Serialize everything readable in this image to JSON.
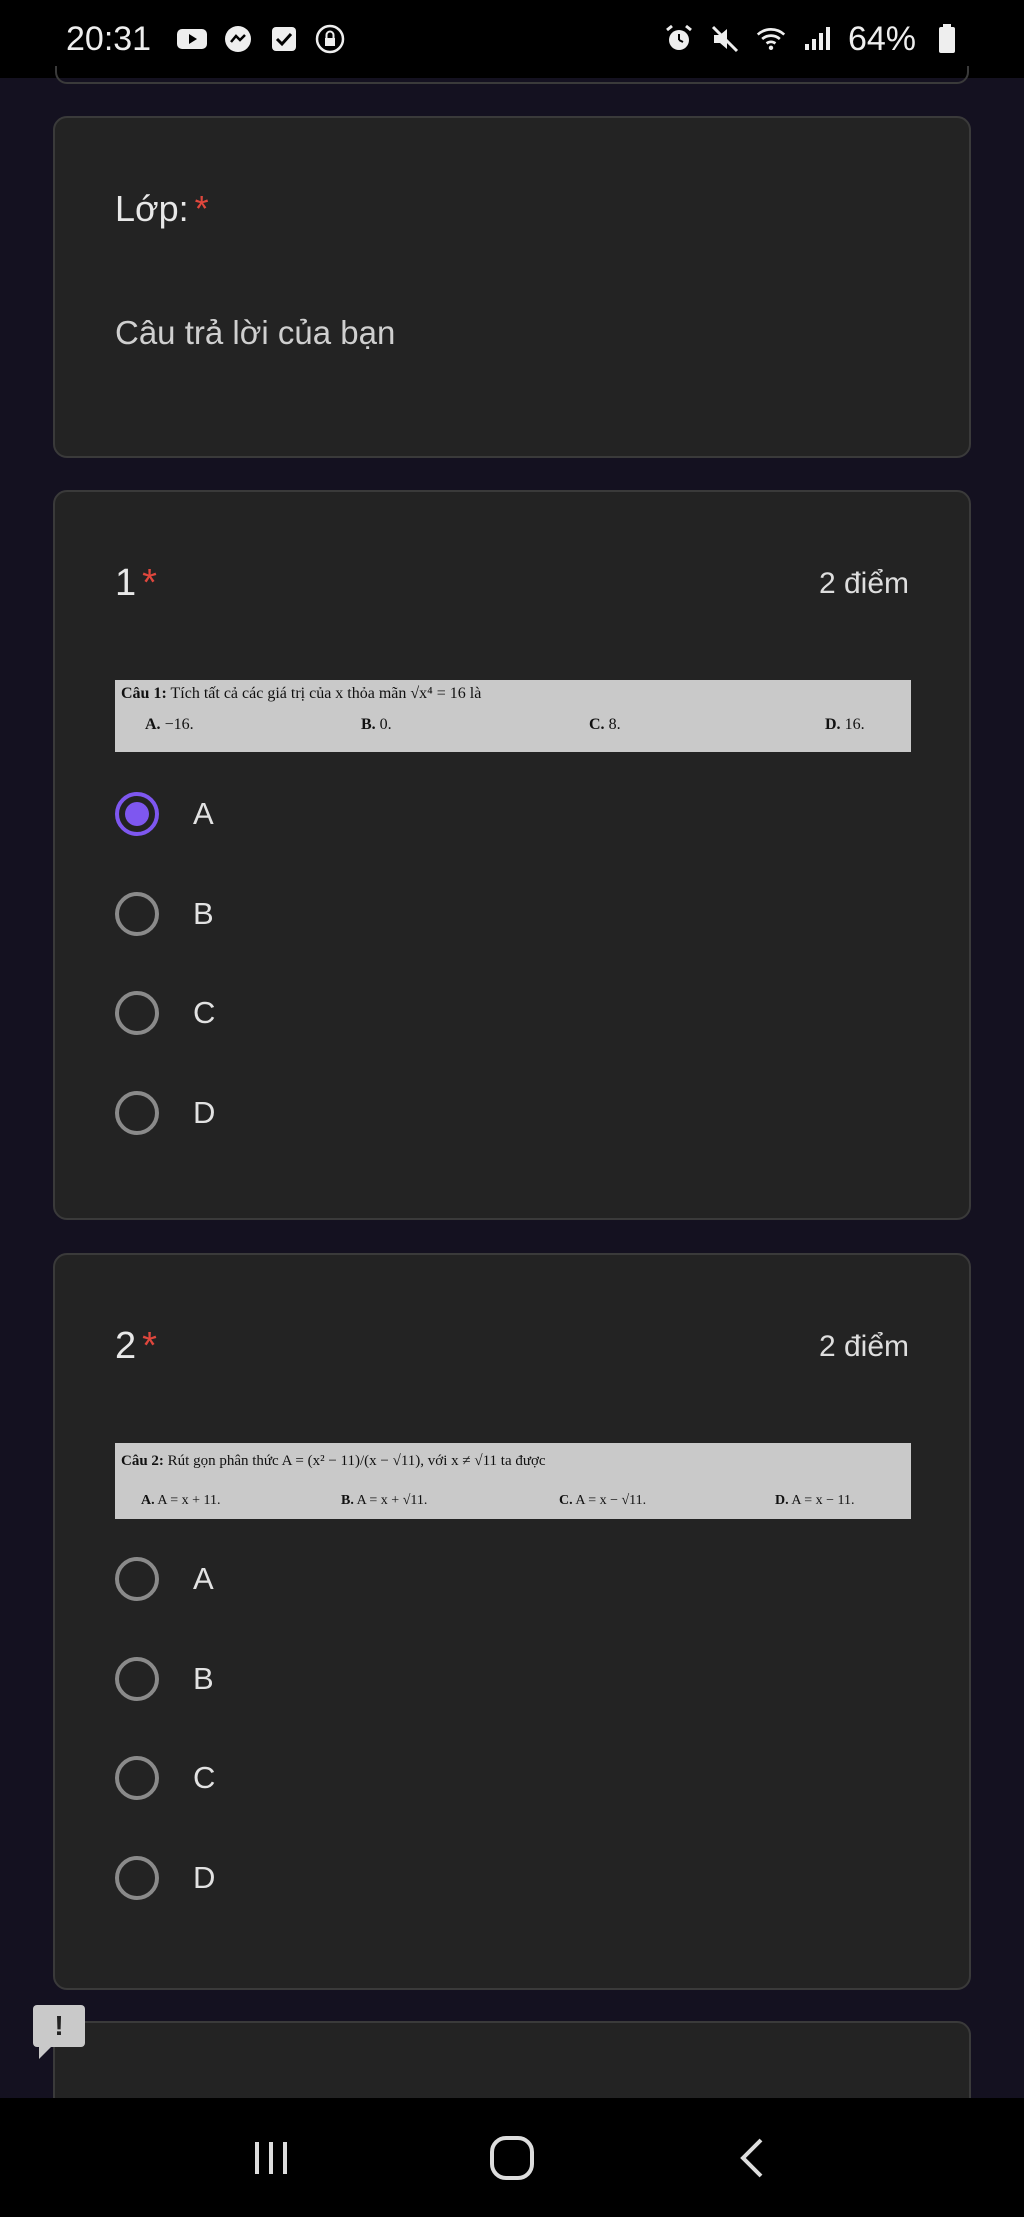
{
  "status_bar": {
    "time": "20:31",
    "battery_pct": "64%",
    "left_icons": [
      "youtube-icon",
      "messenger-icon",
      "checkbox-icon",
      "lock-icon"
    ],
    "right_icons": [
      "alarm-icon",
      "mute-icon",
      "wifi-icon",
      "signal-icon",
      "battery-icon"
    ]
  },
  "class_field": {
    "label": "Lớp:",
    "required_mark": "*",
    "placeholder": "Câu trả lời của bạn"
  },
  "questions": [
    {
      "number": "1",
      "required_mark": "*",
      "points": "2 điểm",
      "stem": "Câu 1: Tích tất cả các giá trị của x thỏa mãn √(x⁴) = 16 là",
      "stem_label": "Câu 1:",
      "stem_text": "Tích tất cả các giá trị của x thỏa mãn √x⁴ = 16 là",
      "image_options": [
        {
          "letter": "A.",
          "text": "−16."
        },
        {
          "letter": "B.",
          "text": "0."
        },
        {
          "letter": "C.",
          "text": "8."
        },
        {
          "letter": "D.",
          "text": "16."
        }
      ],
      "options": [
        "A",
        "B",
        "C",
        "D"
      ],
      "selected": "A"
    },
    {
      "number": "2",
      "required_mark": "*",
      "points": "2 điểm",
      "stem_label": "Câu 2:",
      "stem_text": "Rút gọn phân thức A = (x² − 11)/(x − √11), với x ≠ √11 ta được",
      "image_options": [
        {
          "letter": "A.",
          "text": "A = x + 11."
        },
        {
          "letter": "B.",
          "text": "A = x + √11."
        },
        {
          "letter": "C.",
          "text": "A = x − √11."
        },
        {
          "letter": "D.",
          "text": "A = x − 11."
        }
      ],
      "options": [
        "A",
        "B",
        "C",
        "D"
      ],
      "selected": null
    }
  ],
  "feedback_button": {
    "label": "!"
  },
  "colors": {
    "background": "#141120",
    "card": "#232323",
    "accent": "#7e57f0",
    "required": "#e0473d"
  }
}
